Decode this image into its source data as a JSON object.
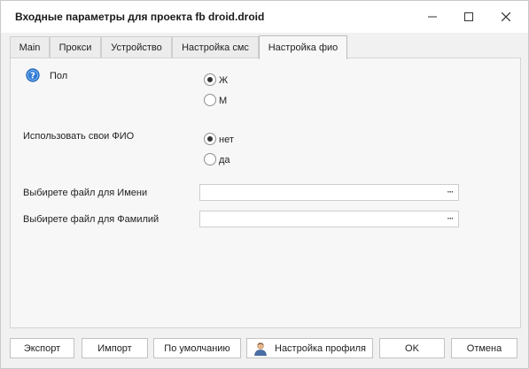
{
  "window": {
    "title": "Входные параметры для проекта fb droid.droid"
  },
  "tabs": [
    {
      "label": "Main",
      "active": false
    },
    {
      "label": "Прокси",
      "active": false
    },
    {
      "label": "Устройство",
      "active": false
    },
    {
      "label": "Настройка смс",
      "active": false
    },
    {
      "label": "Настройка фио",
      "active": true
    }
  ],
  "form": {
    "gender": {
      "label": "Пол",
      "options": [
        {
          "label": "Ж",
          "checked": true
        },
        {
          "label": "М",
          "checked": false
        }
      ]
    },
    "use_own_name": {
      "label": "Использовать свои ФИО",
      "options": [
        {
          "label": "нет",
          "checked": true
        },
        {
          "label": "да",
          "checked": false
        }
      ]
    },
    "first_name_file": {
      "label": "Выбирете файл для Имени",
      "value": "",
      "browse_label": "···"
    },
    "last_name_file": {
      "label": "Выбирете файл для Фамилий",
      "value": "",
      "browse_label": "···"
    }
  },
  "footer": {
    "export_label": "Экспорт",
    "import_label": "Импорт",
    "default_label": "По умолчанию",
    "profile_settings_label": "Настройка профиля",
    "ok_label": "OK",
    "cancel_label": "Отмена"
  },
  "icons": {
    "help": "help-icon",
    "minimize": "minimize-icon",
    "maximize": "maximize-icon",
    "close": "close-icon",
    "profile": "user-profile-icon"
  },
  "colors": {
    "help_icon": "#2f7bd6"
  }
}
